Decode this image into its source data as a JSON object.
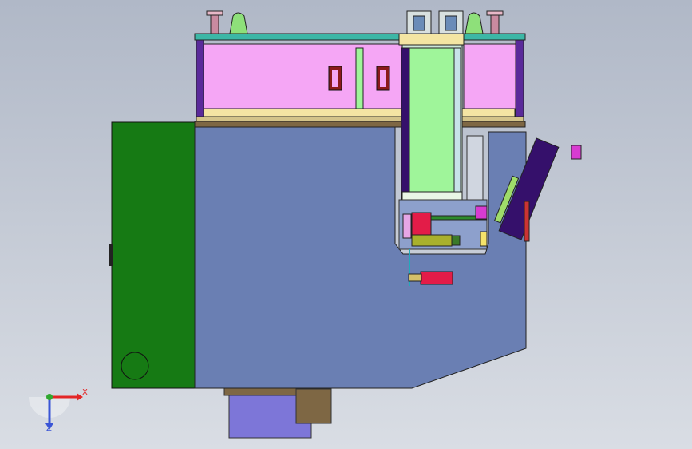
{
  "viewport": {
    "background_top": "#b0b8c7",
    "background_bottom": "#d9dde4"
  },
  "colors": {
    "body_blue": "#6a7fb3",
    "panel_green": "#167a14",
    "pink": "#f5a6f5",
    "column_green": "#9ff59a",
    "cream": "#f4e5a3",
    "teal": "#3cb7a6",
    "purple": "#5a2a9a",
    "navy": "#35106b",
    "red": "#e31c48",
    "olive": "#a9b02c",
    "brown": "#7e6744",
    "lavender": "#7d76d8",
    "magenta": "#d83bd1"
  },
  "triad": {
    "x_label": "X",
    "z_label": "Z",
    "x_color": "#e32626",
    "y_color": "#2fa82f",
    "z_color": "#3a55d6"
  }
}
